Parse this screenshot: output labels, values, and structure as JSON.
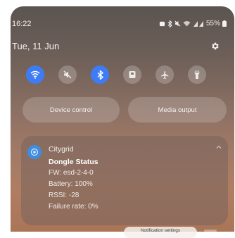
{
  "status_bar": {
    "time": "16:22",
    "battery": "55%",
    "icons": [
      "alarm-icon",
      "bluetooth-icon",
      "mute-icon",
      "wifi-signal-icon",
      "cell-signal-icon",
      "battery-icon"
    ]
  },
  "header": {
    "date": "Tue, 11 Jun"
  },
  "quick_settings": [
    {
      "name": "wifi",
      "icon": "wifi-icon",
      "active": true
    },
    {
      "name": "sound",
      "icon": "mute-icon",
      "active": false
    },
    {
      "name": "bluetooth",
      "icon": "bluetooth-icon",
      "active": true
    },
    {
      "name": "nfc",
      "icon": "nfc-icon",
      "active": false
    },
    {
      "name": "airplane",
      "icon": "airplane-icon",
      "active": false
    },
    {
      "name": "flashlight",
      "icon": "flashlight-icon",
      "active": false
    }
  ],
  "controls": {
    "device_control": "Device control",
    "media_output": "Media output"
  },
  "notification": {
    "app": "Citygrid",
    "title": "Dongle Status",
    "lines": [
      "FW: esd-2-4-0",
      "Battery: 100%",
      "RSSI: -28",
      "Failure rate: 0%"
    ]
  },
  "footer": {
    "notification_settings": "Notification settings"
  },
  "colors": {
    "accent": "#3d7cf4",
    "app_icon": "#3e8de0"
  }
}
